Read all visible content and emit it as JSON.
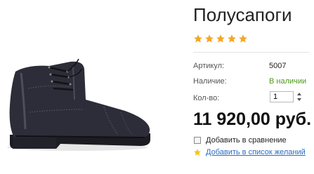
{
  "product": {
    "title": "Полусапоги",
    "rating": 5,
    "rating_max": 5,
    "image_icon": "black-leather-brogue-ankle-boot",
    "article_label": "Артикул:",
    "article_value": "5007",
    "availability_label": "Наличие:",
    "availability_value": "В наличии",
    "quantity_label": "Кол-во:",
    "quantity_value": "1",
    "price": "11 920,00 руб.",
    "compare_label": "Добавить в сравнение",
    "wishlist_label": "Добавить в список желаний"
  },
  "colors": {
    "star": "#f5a623",
    "in_stock": "#4c9a1c",
    "link": "#2a6cc0"
  }
}
